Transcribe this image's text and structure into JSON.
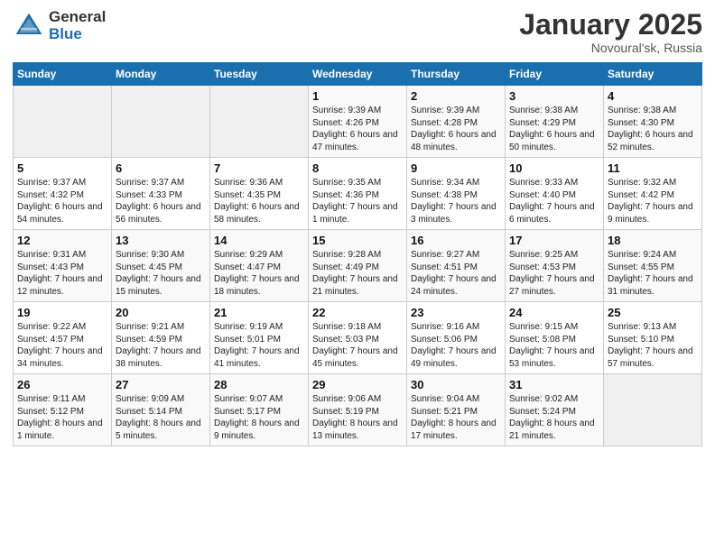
{
  "header": {
    "logo_general": "General",
    "logo_blue": "Blue",
    "month_title": "January 2025",
    "location": "Novoural'sk, Russia"
  },
  "weekdays": [
    "Sunday",
    "Monday",
    "Tuesday",
    "Wednesday",
    "Thursday",
    "Friday",
    "Saturday"
  ],
  "weeks": [
    [
      {
        "day": "",
        "sunrise": "",
        "sunset": "",
        "daylight": ""
      },
      {
        "day": "",
        "sunrise": "",
        "sunset": "",
        "daylight": ""
      },
      {
        "day": "",
        "sunrise": "",
        "sunset": "",
        "daylight": ""
      },
      {
        "day": "1",
        "sunrise": "Sunrise: 9:39 AM",
        "sunset": "Sunset: 4:26 PM",
        "daylight": "Daylight: 6 hours and 47 minutes."
      },
      {
        "day": "2",
        "sunrise": "Sunrise: 9:39 AM",
        "sunset": "Sunset: 4:28 PM",
        "daylight": "Daylight: 6 hours and 48 minutes."
      },
      {
        "day": "3",
        "sunrise": "Sunrise: 9:38 AM",
        "sunset": "Sunset: 4:29 PM",
        "daylight": "Daylight: 6 hours and 50 minutes."
      },
      {
        "day": "4",
        "sunrise": "Sunrise: 9:38 AM",
        "sunset": "Sunset: 4:30 PM",
        "daylight": "Daylight: 6 hours and 52 minutes."
      }
    ],
    [
      {
        "day": "5",
        "sunrise": "Sunrise: 9:37 AM",
        "sunset": "Sunset: 4:32 PM",
        "daylight": "Daylight: 6 hours and 54 minutes."
      },
      {
        "day": "6",
        "sunrise": "Sunrise: 9:37 AM",
        "sunset": "Sunset: 4:33 PM",
        "daylight": "Daylight: 6 hours and 56 minutes."
      },
      {
        "day": "7",
        "sunrise": "Sunrise: 9:36 AM",
        "sunset": "Sunset: 4:35 PM",
        "daylight": "Daylight: 6 hours and 58 minutes."
      },
      {
        "day": "8",
        "sunrise": "Sunrise: 9:35 AM",
        "sunset": "Sunset: 4:36 PM",
        "daylight": "Daylight: 7 hours and 1 minute."
      },
      {
        "day": "9",
        "sunrise": "Sunrise: 9:34 AM",
        "sunset": "Sunset: 4:38 PM",
        "daylight": "Daylight: 7 hours and 3 minutes."
      },
      {
        "day": "10",
        "sunrise": "Sunrise: 9:33 AM",
        "sunset": "Sunset: 4:40 PM",
        "daylight": "Daylight: 7 hours and 6 minutes."
      },
      {
        "day": "11",
        "sunrise": "Sunrise: 9:32 AM",
        "sunset": "Sunset: 4:42 PM",
        "daylight": "Daylight: 7 hours and 9 minutes."
      }
    ],
    [
      {
        "day": "12",
        "sunrise": "Sunrise: 9:31 AM",
        "sunset": "Sunset: 4:43 PM",
        "daylight": "Daylight: 7 hours and 12 minutes."
      },
      {
        "day": "13",
        "sunrise": "Sunrise: 9:30 AM",
        "sunset": "Sunset: 4:45 PM",
        "daylight": "Daylight: 7 hours and 15 minutes."
      },
      {
        "day": "14",
        "sunrise": "Sunrise: 9:29 AM",
        "sunset": "Sunset: 4:47 PM",
        "daylight": "Daylight: 7 hours and 18 minutes."
      },
      {
        "day": "15",
        "sunrise": "Sunrise: 9:28 AM",
        "sunset": "Sunset: 4:49 PM",
        "daylight": "Daylight: 7 hours and 21 minutes."
      },
      {
        "day": "16",
        "sunrise": "Sunrise: 9:27 AM",
        "sunset": "Sunset: 4:51 PM",
        "daylight": "Daylight: 7 hours and 24 minutes."
      },
      {
        "day": "17",
        "sunrise": "Sunrise: 9:25 AM",
        "sunset": "Sunset: 4:53 PM",
        "daylight": "Daylight: 7 hours and 27 minutes."
      },
      {
        "day": "18",
        "sunrise": "Sunrise: 9:24 AM",
        "sunset": "Sunset: 4:55 PM",
        "daylight": "Daylight: 7 hours and 31 minutes."
      }
    ],
    [
      {
        "day": "19",
        "sunrise": "Sunrise: 9:22 AM",
        "sunset": "Sunset: 4:57 PM",
        "daylight": "Daylight: 7 hours and 34 minutes."
      },
      {
        "day": "20",
        "sunrise": "Sunrise: 9:21 AM",
        "sunset": "Sunset: 4:59 PM",
        "daylight": "Daylight: 7 hours and 38 minutes."
      },
      {
        "day": "21",
        "sunrise": "Sunrise: 9:19 AM",
        "sunset": "Sunset: 5:01 PM",
        "daylight": "Daylight: 7 hours and 41 minutes."
      },
      {
        "day": "22",
        "sunrise": "Sunrise: 9:18 AM",
        "sunset": "Sunset: 5:03 PM",
        "daylight": "Daylight: 7 hours and 45 minutes."
      },
      {
        "day": "23",
        "sunrise": "Sunrise: 9:16 AM",
        "sunset": "Sunset: 5:06 PM",
        "daylight": "Daylight: 7 hours and 49 minutes."
      },
      {
        "day": "24",
        "sunrise": "Sunrise: 9:15 AM",
        "sunset": "Sunset: 5:08 PM",
        "daylight": "Daylight: 7 hours and 53 minutes."
      },
      {
        "day": "25",
        "sunrise": "Sunrise: 9:13 AM",
        "sunset": "Sunset: 5:10 PM",
        "daylight": "Daylight: 7 hours and 57 minutes."
      }
    ],
    [
      {
        "day": "26",
        "sunrise": "Sunrise: 9:11 AM",
        "sunset": "Sunset: 5:12 PM",
        "daylight": "Daylight: 8 hours and 1 minute."
      },
      {
        "day": "27",
        "sunrise": "Sunrise: 9:09 AM",
        "sunset": "Sunset: 5:14 PM",
        "daylight": "Daylight: 8 hours and 5 minutes."
      },
      {
        "day": "28",
        "sunrise": "Sunrise: 9:07 AM",
        "sunset": "Sunset: 5:17 PM",
        "daylight": "Daylight: 8 hours and 9 minutes."
      },
      {
        "day": "29",
        "sunrise": "Sunrise: 9:06 AM",
        "sunset": "Sunset: 5:19 PM",
        "daylight": "Daylight: 8 hours and 13 minutes."
      },
      {
        "day": "30",
        "sunrise": "Sunrise: 9:04 AM",
        "sunset": "Sunset: 5:21 PM",
        "daylight": "Daylight: 8 hours and 17 minutes."
      },
      {
        "day": "31",
        "sunrise": "Sunrise: 9:02 AM",
        "sunset": "Sunset: 5:24 PM",
        "daylight": "Daylight: 8 hours and 21 minutes."
      },
      {
        "day": "",
        "sunrise": "",
        "sunset": "",
        "daylight": ""
      }
    ]
  ]
}
